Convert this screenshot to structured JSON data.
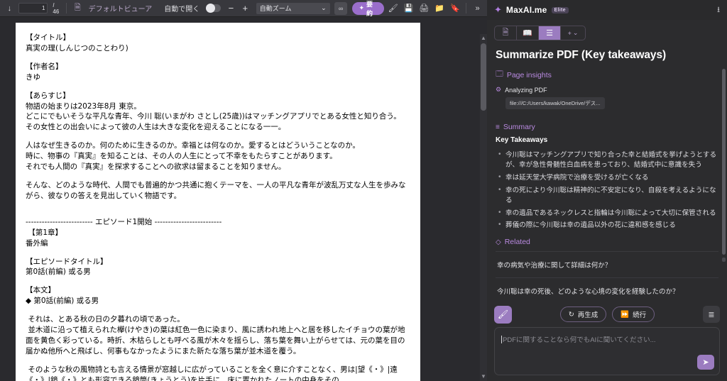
{
  "pdf_toolbar": {
    "download_icon": "download-icon",
    "page_current": "1",
    "page_total": "/ 46",
    "viewer_icon": "pdf-file-icon",
    "viewer_label": "デフォルトビューア",
    "auto_open_label": "自動で開く",
    "toggle_state": "off",
    "zoom_out": "−",
    "zoom_in": "+",
    "zoom_level": "自動ズーム",
    "chevron": "⌄",
    "infinity_label": "∞",
    "summarize_label": "要約",
    "summarize_icon": "sparkle-icon",
    "right_icons": [
      "presentation-icon",
      "save-icon",
      "print-icon",
      "open-file-icon",
      "bookmark-icon",
      "more-icon"
    ],
    "more_label": "»"
  },
  "pdf_page": {
    "lines": [
      "【タイトル】",
      "真実の理(しんじつのことわり)",
      "",
      "【作者名】",
      "きゆ",
      "",
      "【あらすじ】",
      "物語の始まりは2023年8月 東京。",
      "どこにでもいそうな平凡な青年、今川 聡(いまがわ さとし(25歳))はマッチングアプリでとある女性と知り合う。",
      "その女性との出会いによって彼の人生は大きな変化を迎えることになる一一。",
      "",
      "人はなぜ生きるのか。何のために生きるのか。幸福とは何なのか。愛するとはどういうことなのか。",
      "時に、物事の『真実』を知ることは、その人の人生にとって不幸をもたらすことがあります。",
      "それでも人間の『真実』を探求することへの欲求は留まることを知りません。",
      "",
      "そんな、どのような時代、人間でも普遍的かつ共通に抱くテーマを、一人の平凡な青年が波乱万丈な人生を歩みながら、彼なりの答えを見出していく物語です。",
      "",
      "",
      "------------------------- エピソード1開始 -------------------------",
      " 【第1章】",
      "番外編",
      "",
      "【エピソードタイトル】",
      "第0話(前編) 或る男",
      "",
      "【本文】",
      "◆ 第0話(前編) 或る男",
      "",
      " それは、とある秋の日の夕暮れの頃であった。",
      " 並木道に沿って植えられた欅(けやき)の葉は紅色一色に染まり、風に誘われ地上へと居を移したイチョウの葉が地面を黄色く彩っている。時折、木枯らしとも呼べる風が木々を揺らし、落ち葉を舞い上がらせては、元の葉を目の届かぬ他所へと飛ばし、何事もなかったようにまた新たな落ち葉が並木道を覆う。",
      "",
      " そのような秋の風物詩とも言える情景が窓越しに広がっていることを全く意に介すことなく、男は|望《・》|遠《・》|鏡《・》とも形容できる鏡筒(きょうとう)を片手に、床に置かれたノートの中身をその"
    ]
  },
  "max_panel": {
    "brand": "MaxAI.me",
    "badge": "Elite",
    "download_icon": "download-icon",
    "tabs": [
      {
        "name": "tab-document",
        "icon": "document-icon",
        "active": false
      },
      {
        "name": "tab-read",
        "icon": "book-icon",
        "active": false
      },
      {
        "name": "tab-summary",
        "icon": "list-icon",
        "active": true
      },
      {
        "name": "tab-add",
        "icon": "plus-chevron-icon",
        "active": false
      }
    ],
    "tab_plus_label": "+",
    "tab_chevron_label": "⌄",
    "summary_title": "Summarize PDF (Key takeaways)",
    "page_insights_label": "Page insights",
    "page_insights_icon": "monitor-icon",
    "analyzing_label": "Analyzing PDF",
    "analyzing_icon": "gear-icon",
    "file_path": "file:///C:/Users/kawak/OneDrive/デス...",
    "summary_section_label": "Summary",
    "summary_section_icon": "list-lines-icon",
    "key_takeaways_heading": "Key Takeaways",
    "key_takeaways": [
      "今川聡はマッチングアプリで知り合った幸と結婚式を挙げようとするが、幸が急性骨髄性白血病を患っており、結婚式中に意識を失う",
      "幸は延天堂大学病院で治療を受けるが亡くなる",
      "幸の死により今川聡は精神的に不安定になり、自殺を考えるようになる",
      "幸の遺品であるネックレスと指輪は今川聡によって大切に保管される",
      "葬儀の際に今川聡は幸の遺品以外の花に違和感を感じる"
    ],
    "related_label": "Related",
    "related_icon": "layers-icon",
    "related_questions": [
      "幸の病気や治療に関して詳細は何か？",
      "今川聡は幸の死後、どのような心境の変化を経験したのか？"
    ],
    "actions": {
      "brush_icon": "brush-icon",
      "regenerate_label": "再生成",
      "regenerate_icon": "refresh-icon",
      "continue_label": "続行",
      "continue_icon": "fast-forward-icon",
      "settings_icon": "sliders-icon"
    },
    "input": {
      "placeholder": "PDFに関することなら何でもAIに聞いてください...",
      "send_icon": "send-icon"
    }
  },
  "colors": {
    "accent_purple": "#9b7cc0",
    "header_purple_text": "#b98ae0",
    "panel_bg": "#2c2c2e",
    "toolbar_bg": "#38383d"
  }
}
